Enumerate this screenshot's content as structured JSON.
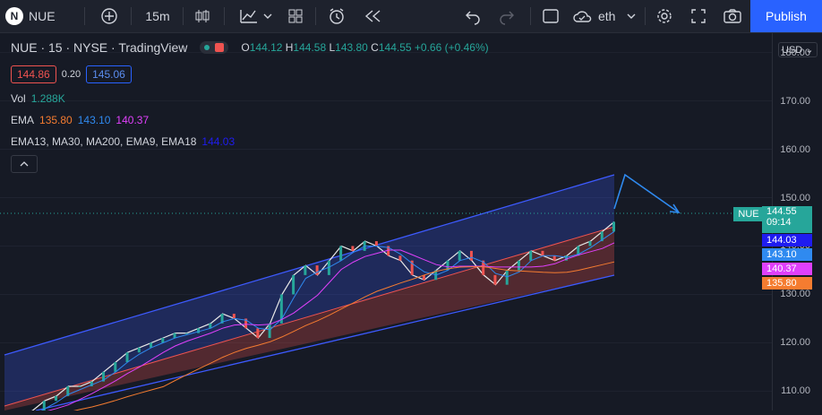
{
  "toolbar": {
    "symbol": "NUE",
    "interval": "15m",
    "layout_name": "eth",
    "publish_label": "Publish"
  },
  "legend": {
    "title": "NUE · 15 · NYSE · TradingView",
    "ohlc": {
      "o": "144.12",
      "h": "144.58",
      "l": "143.80",
      "c": "144.55",
      "change": "+0.66 (+0.46%)"
    },
    "bid": "144.86",
    "spread": "0.20",
    "ask": "145.06",
    "vol_label": "Vol",
    "vol": "1.288K",
    "ema_label": "EMA",
    "ema_values": [
      "135.80",
      "143.10",
      "140.37"
    ],
    "indicators": "EMA13, MA30, MA200, EMA9, EMA18",
    "indicators_value": "144.03"
  },
  "price_axis": {
    "currency": "USD",
    "ticks": [
      "180.00",
      "170.00",
      "160.00",
      "150.00",
      "140.00",
      "130.00",
      "120.00",
      "110.00"
    ],
    "current_label": "NUE",
    "current_price": "144.55",
    "countdown": "09:14",
    "tags": [
      {
        "value": "144.03",
        "color": "#1f1cf0"
      },
      {
        "value": "143.10",
        "color": "#2f8af0"
      },
      {
        "value": "140.37",
        "color": "#e040fb"
      },
      {
        "value": "135.80",
        "color": "#f57c30"
      }
    ]
  },
  "colors": {
    "up": "#26a69a",
    "down": "#ef5350",
    "channel_top": "#3d5afe",
    "channel_bottom": "#ef5350",
    "accent": "#2962ff"
  },
  "chart_data": {
    "type": "line",
    "series": [
      {
        "values": [
          104,
          105,
          106,
          108,
          109,
          111,
          111,
          112,
          114,
          116,
          118,
          119,
          120,
          121,
          122,
          122,
          123,
          124,
          126,
          125,
          123,
          121,
          124,
          130,
          134,
          136,
          134,
          137,
          140,
          139,
          141,
          140,
          138,
          137,
          134,
          133,
          135,
          137,
          139,
          137,
          134,
          132,
          135,
          137,
          139,
          138,
          137,
          138,
          140,
          141,
          143,
          145
        ]
      }
    ],
    "ylim": [
      106,
      184
    ]
  }
}
